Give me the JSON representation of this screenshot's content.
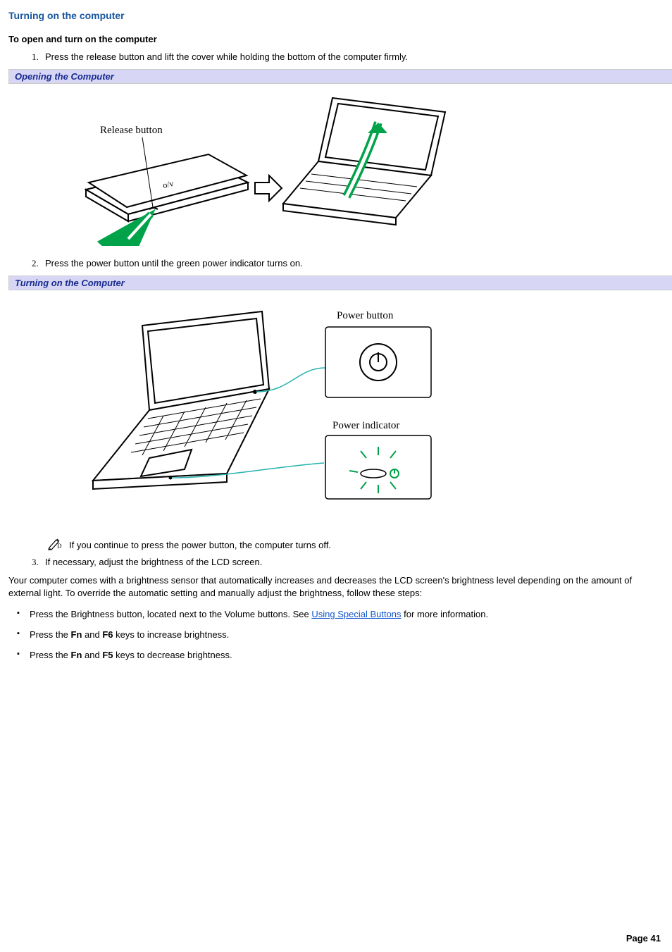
{
  "section": {
    "title": "Turning on the computer",
    "subheading": "To open and turn on the computer"
  },
  "steps": {
    "s1": "Press the release button and lift the cover while holding the bottom of the computer firmly.",
    "s2": "Press the power button until the green power indicator turns on.",
    "s3": "If necessary, adjust the brightness of the LCD screen."
  },
  "figures": {
    "fig1": {
      "caption": "Opening the Computer",
      "labels": {
        "release_button": "Release button"
      }
    },
    "fig2": {
      "caption": "Turning on the Computer",
      "labels": {
        "power_button": "Power button",
        "power_indicator": "Power indicator"
      }
    }
  },
  "note": {
    "text": "If you continue to press the power button, the computer turns off."
  },
  "paragraph": "Your computer comes with a brightness sensor that automatically increases and decreases the LCD screen's brightness level depending on the amount of external light. To override the automatic setting and manually adjust the brightness, follow these steps:",
  "bullets": {
    "b1_pre": "Press the Brightness button, located next to the Volume buttons. See ",
    "b1_link": "Using Special Buttons",
    "b1_post": " for more information.",
    "b2_pre": "Press the ",
    "b2_k1": "Fn",
    "b2_mid": " and ",
    "b2_k2": "F6",
    "b2_post": " keys to increase brightness.",
    "b3_pre": "Press the ",
    "b3_k1": "Fn",
    "b3_mid": " and ",
    "b3_k2": "F5",
    "b3_post": " keys to decrease brightness."
  },
  "footer": {
    "page_label": "Page 41"
  }
}
